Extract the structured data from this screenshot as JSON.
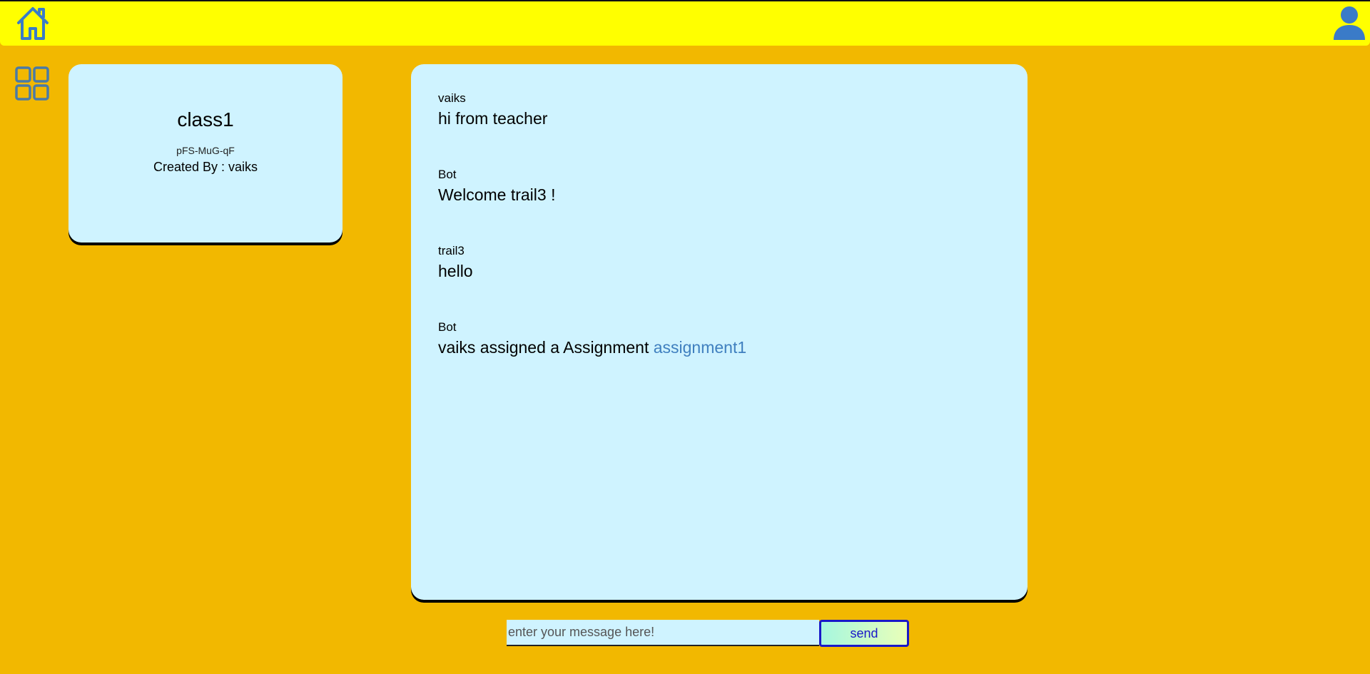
{
  "header": {
    "home_icon": "home-icon",
    "user_icon": "user-icon",
    "accent_color": "#ffff00",
    "icon_color": "#3a7bc8"
  },
  "sidebar": {
    "grid_icon": "grid-icon",
    "icon_color": "#4a7aa6"
  },
  "class_card": {
    "name": "class1",
    "code": "pFS-MuG-qF",
    "created_by": "Created By : vaiks"
  },
  "chat": {
    "messages": [
      {
        "author": "vaiks",
        "text": "hi from teacher"
      },
      {
        "author": "Bot",
        "text": "Welcome trail3 !"
      },
      {
        "author": "trail3",
        "text": "hello"
      },
      {
        "author": "Bot",
        "text": "vaiks assigned a Assignment ",
        "link": "assignment1"
      }
    ],
    "link_color": "#3f7fbf"
  },
  "composer": {
    "placeholder": "enter your message here!",
    "value": "",
    "send_label": "send"
  },
  "colors": {
    "background": "#f2b800",
    "panel": "#cff3ff"
  }
}
